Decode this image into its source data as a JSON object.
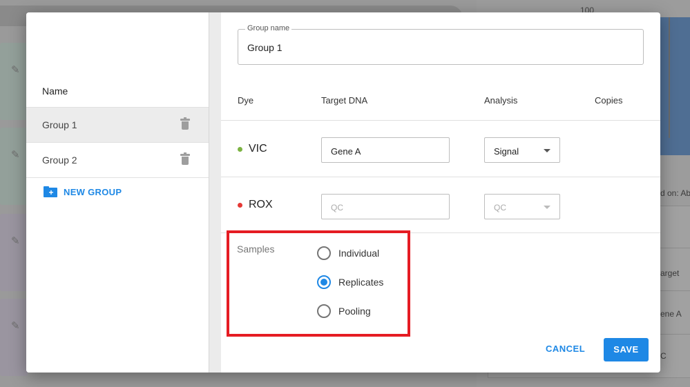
{
  "background": {
    "axis_tick": "100",
    "partial_text_1": "d on: Ab",
    "partial_text_2": "arget",
    "partial_text_3": "ene A",
    "partial_text_4": "C"
  },
  "sidebar": {
    "header": "Name",
    "groups": [
      {
        "label": "Group 1",
        "selected": true
      },
      {
        "label": "Group 2",
        "selected": false
      }
    ],
    "new_group_label": "NEW GROUP"
  },
  "form": {
    "group_name_label": "Group name",
    "group_name_value": "Group 1",
    "columns": [
      "Dye",
      "Target DNA",
      "Analysis",
      "Copies"
    ],
    "rows": [
      {
        "dye": "VIC",
        "dot_color": "#7cb342",
        "target": "Gene A",
        "target_placeholder": "",
        "analysis": "Signal",
        "disabled": false
      },
      {
        "dye": "ROX",
        "dot_color": "#e53935",
        "target": "",
        "target_placeholder": "QC",
        "analysis": "QC",
        "disabled": true
      }
    ],
    "samples_label": "Samples",
    "sample_options": [
      {
        "label": "Individual",
        "checked": false
      },
      {
        "label": "Replicates",
        "checked": true
      },
      {
        "label": "Pooling",
        "checked": false
      }
    ]
  },
  "actions": {
    "cancel_label": "CANCEL",
    "save_label": "SAVE"
  },
  "colors": {
    "accent": "#1e88e5",
    "highlight": "#e51c23"
  }
}
